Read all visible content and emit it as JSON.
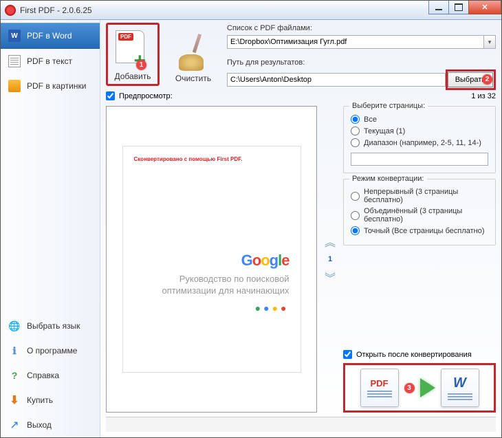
{
  "window": {
    "title": "First PDF - 2.0.6.25"
  },
  "sidebar": {
    "top": [
      {
        "label": "PDF в Word"
      },
      {
        "label": "PDF в текст"
      },
      {
        "label": "PDF в картинки"
      }
    ],
    "bottom": [
      {
        "label": "Выбрать язык"
      },
      {
        "label": "О программе"
      },
      {
        "label": "Справка"
      },
      {
        "label": "Купить"
      },
      {
        "label": "Выход"
      }
    ]
  },
  "toolbar": {
    "add_label": "Добавить",
    "clear_label": "Очистить"
  },
  "paths": {
    "files_label": "Список с PDF файлами:",
    "files_value": "E:\\Dropbox\\Оптимизация Гугл.pdf",
    "output_label": "Путь для результатов:",
    "output_value": "C:\\Users\\Anton\\Desktop",
    "select_btn": "Выбрать"
  },
  "preview": {
    "label": "Предпросмотр:",
    "page_of": "1 из 32",
    "watermark": "Сконвертировано с помощью First PDF.",
    "doc_title_l1": "Руководство по поисковой",
    "doc_title_l2": "оптимизации для начинающих",
    "current_page": "1"
  },
  "pages_group": {
    "legend": "Выберите страницы:",
    "all": "Все",
    "current": "Текущая (1)",
    "range": "Диапазон (например, 2-5, 11, 14-)"
  },
  "mode_group": {
    "legend": "Режим конвертации:",
    "continuous": "Непрерывный (3 страницы бесплатно)",
    "merged": "Объединённый (3 страницы бесплатно)",
    "exact": "Точный (Все страницы бесплатно)"
  },
  "bottom": {
    "open_after": "Открыть после конвертирования",
    "pdf_label": "PDF",
    "word_label": "W"
  },
  "annotations": {
    "a1": "1",
    "a2": "2",
    "a3": "3"
  }
}
